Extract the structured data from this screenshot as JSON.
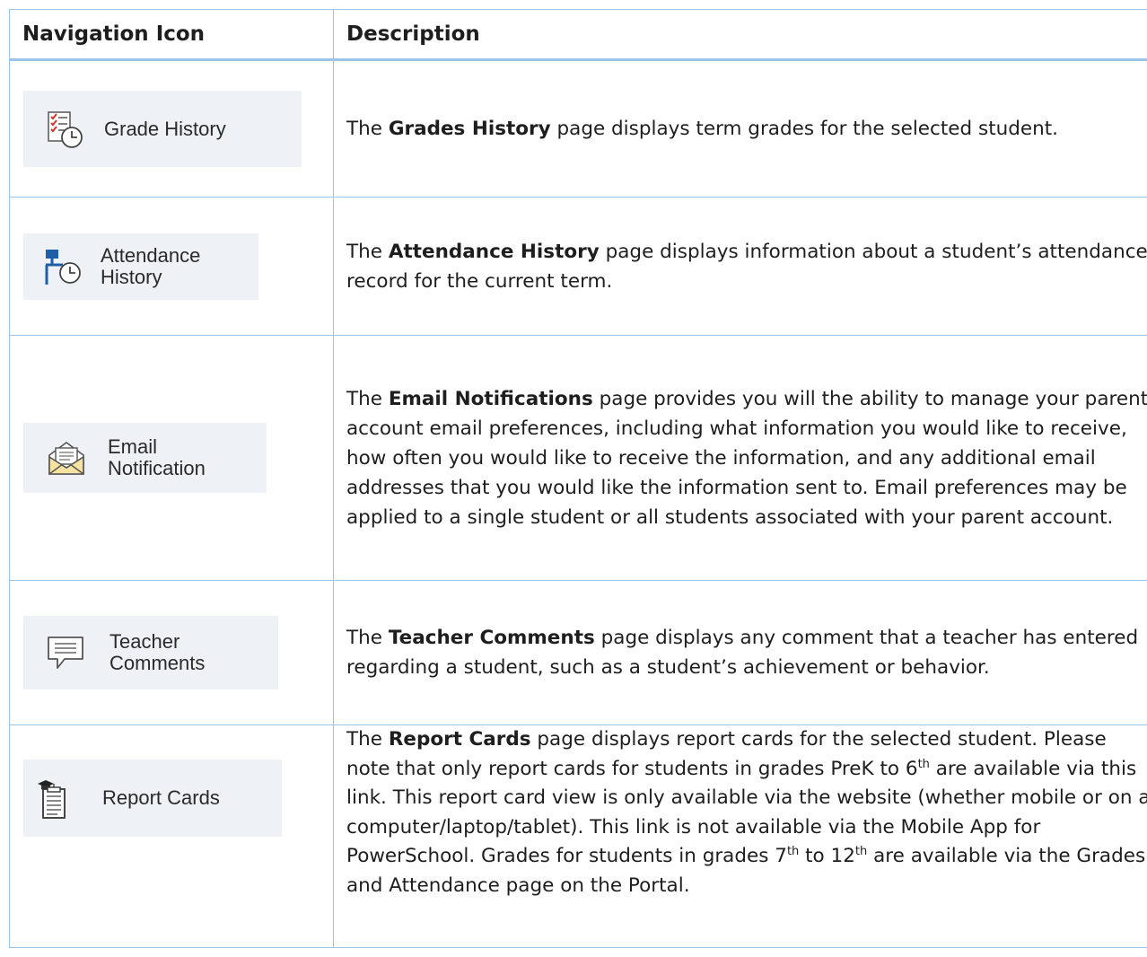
{
  "header": {
    "col1": "Navigation Icon",
    "col2": "Description"
  },
  "rows": [
    {
      "icon": "grade-history-icon",
      "label": "Grade History",
      "pre": "The ",
      "bold": "Grades History",
      "post": " page displays term grades for the selected student."
    },
    {
      "icon": "attendance-history-icon",
      "label1": "Attendance",
      "label2": "History",
      "pre": "The ",
      "bold": "Attendance History",
      "post": " page displays information about a student’s attendance record for the current term."
    },
    {
      "icon": "email-envelope-icon",
      "label1": "Email",
      "label2": "Notification",
      "pre": "The ",
      "bold": "Email Notifications",
      "post": " page provides you will the ability to manage your parent account email preferences, including what information you would like to receive, how often you would like to receive the information, and any additional email addresses that you would like the information sent to.  Email preferences may be applied to a single student or all students associated with your parent account."
    },
    {
      "icon": "comment-bubble-icon",
      "label1": "Teacher",
      "label2": "Comments",
      "pre": "The ",
      "bold": "Teacher Comments",
      "post": " page displays any comment that a teacher has entered regarding a student, such as a student’s achievement or behavior."
    },
    {
      "icon": "report-card-icon",
      "label": "Report Cards",
      "pre": "The ",
      "bold": "Report Cards",
      "t1": " page displays report cards for the selected student. Please note that only report cards for students in grades PreK to 6",
      "sup1": "th",
      "t2": " are available via this link. This report card view is only available via the website (whether mobile or on a computer/laptop/tablet). This link is not available via the Mobile App for PowerSchool. Grades for students in grades 7",
      "sup2": "th",
      "t3": " to 12",
      "sup3": "th",
      "t4": " are available via the Grades and Attendance page on the Portal."
    }
  ]
}
